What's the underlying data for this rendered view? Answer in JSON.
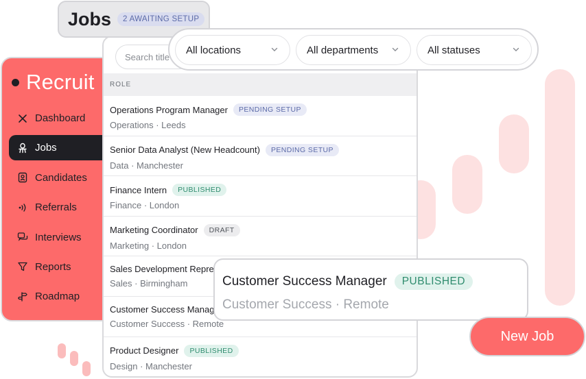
{
  "app": {
    "brand": "Recruit"
  },
  "sidebar": {
    "items": [
      {
        "label": "Dashboard",
        "icon": "close-x-icon"
      },
      {
        "label": "Jobs",
        "icon": "chair-icon",
        "active": true
      },
      {
        "label": "Candidates",
        "icon": "id-badge-icon"
      },
      {
        "label": "Referrals",
        "icon": "broadcast-icon"
      },
      {
        "label": "Interviews",
        "icon": "chat-bubbles-icon"
      },
      {
        "label": "Reports",
        "icon": "funnel-icon"
      },
      {
        "label": "Roadmap",
        "icon": "signpost-icon"
      }
    ]
  },
  "header": {
    "title": "Jobs",
    "badge": "2 AWAITING SETUP"
  },
  "search": {
    "placeholder": "Search title"
  },
  "filters": {
    "location": "All locations",
    "department": "All departments",
    "status": "All statuses"
  },
  "table": {
    "column_header": "ROLE",
    "rows": [
      {
        "title": "Operations Program Manager",
        "status": "PENDING SETUP",
        "meta": "Operations · Leeds"
      },
      {
        "title": "Senior Data Analyst (New Headcount)",
        "status": "PENDING SETUP",
        "meta": "Data · Manchester"
      },
      {
        "title": "Finance Intern",
        "status": "PUBLISHED",
        "meta": "Finance · London"
      },
      {
        "title": "Marketing Coordinator",
        "status": "DRAFT",
        "meta": "Marketing · London"
      },
      {
        "title": "Sales Development Repre",
        "status": "",
        "meta": "Sales · Birmingham"
      },
      {
        "title": "Customer Success Manag",
        "status": "",
        "meta": "Customer Success · Remote"
      },
      {
        "title": "Product Designer",
        "status": "PUBLISHED",
        "meta": "Design · Manchester"
      }
    ]
  },
  "detail": {
    "title": "Customer Success Manager",
    "status": "PUBLISHED",
    "meta": "Customer Success · Remote"
  },
  "actions": {
    "new_job": "New Job"
  },
  "colors": {
    "brand": "#fd6a6a",
    "dark": "#1f1f24",
    "published": "#2f8c6e",
    "pending": "#5b6aa8"
  }
}
